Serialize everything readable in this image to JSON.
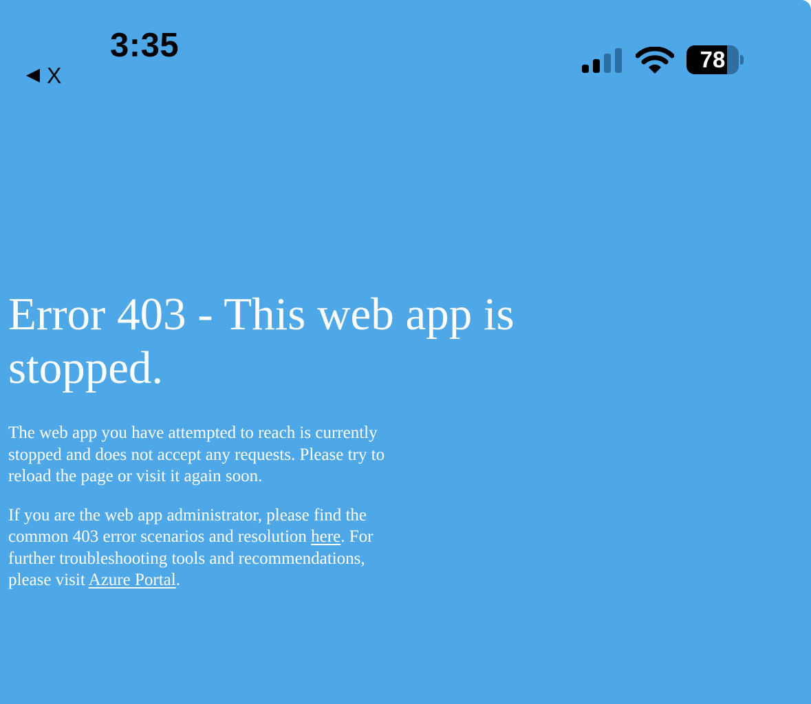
{
  "status_bar": {
    "time": "3:35",
    "back_label": "X",
    "battery_level": "78",
    "battery_fraction": 0.78,
    "signal_bars_active": 2,
    "signal_bars_total": 4,
    "icons": {
      "back": "back-arrow-icon",
      "signal": "cellular-signal-icon",
      "wifi": "wifi-icon",
      "battery": "battery-icon"
    }
  },
  "page": {
    "title": "Error 403 - This web app is stopped.",
    "paragraph1": "The web app you have attempted to reach is currently stopped and does not accept any requests. Please try to reload the page or visit it again soon.",
    "paragraph2": {
      "text_before_link1": "If you are the web app administrator, please find the common 403 error scenarios and resolution ",
      "link1_label": "here",
      "text_after_link1": ". For further troubleshooting tools and recommendations, please visit ",
      "link2_label": "Azure Portal",
      "text_after_link2": "."
    }
  },
  "colors": {
    "background": "#4ea7e6",
    "text": "#ffffff",
    "status_text": "#000000",
    "inactive_indicator": "#2d6fa3"
  }
}
